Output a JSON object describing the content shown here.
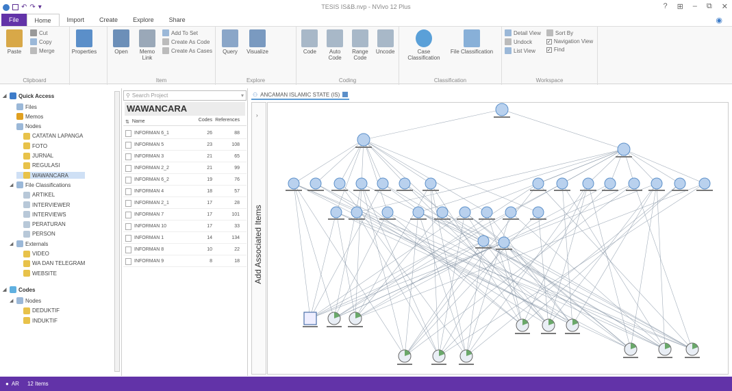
{
  "window": {
    "title": "TESIS IS&B.nvp - NVivo 12 Plus",
    "quick_access": [
      "save-icon",
      "undo-icon",
      "redo-icon",
      "dropdown-icon"
    ],
    "controls": [
      "?",
      "⊞",
      "–",
      "⧉",
      "✕"
    ]
  },
  "tabs": [
    {
      "label": "File",
      "kind": "file"
    },
    {
      "label": "Home",
      "kind": "active"
    },
    {
      "label": "Import",
      "kind": ""
    },
    {
      "label": "Create",
      "kind": ""
    },
    {
      "label": "Explore",
      "kind": ""
    },
    {
      "label": "Share",
      "kind": ""
    }
  ],
  "ribbon": {
    "clipboard": {
      "label": "Clipboard",
      "paste": "Paste",
      "cut": "Cut",
      "copy": "Copy",
      "merge": "Merge"
    },
    "properties": {
      "label": "",
      "properties": "Properties"
    },
    "item": {
      "label": "Item",
      "open": "Open",
      "memo_link": "Memo Link",
      "add_to_set": "Add To Set",
      "create_as_code": "Create As Code",
      "create_as_cases": "Create As Cases"
    },
    "explore": {
      "label": "Explore",
      "query": "Query",
      "visualize": "Visualize"
    },
    "coding": {
      "label": "Coding",
      "code": "Code",
      "auto_code": "Auto Code",
      "range_code": "Range Code",
      "uncode": "Uncode"
    },
    "classification": {
      "label": "Classification",
      "case": "Case Classification",
      "file": "File Classification"
    },
    "workspace": {
      "label": "Workspace",
      "detail_view": "Detail View",
      "sort_by": "Sort By",
      "undock": "Undock",
      "navigation_view": "Navigation View",
      "list_view": "List View",
      "find": "Find"
    }
  },
  "nav": {
    "items": [
      {
        "label": "Quick Access",
        "level": 0,
        "bold": true,
        "exp": "◢",
        "color": "#3d7cc9"
      },
      {
        "label": "Files",
        "level": 1,
        "color": "#9bb8d8"
      },
      {
        "label": "Memos",
        "level": 1,
        "color": "#e0a020"
      },
      {
        "label": "Nodes",
        "level": 1,
        "color": "#9bb8d8"
      },
      {
        "label": "CATATAN LAPANGA",
        "level": 2,
        "color": "#e8c24a"
      },
      {
        "label": "FOTO",
        "level": 2,
        "color": "#e8c24a"
      },
      {
        "label": "JURNAL",
        "level": 2,
        "color": "#e8c24a"
      },
      {
        "label": "REGULASI",
        "level": 2,
        "color": "#e8c24a"
      },
      {
        "label": "WAWANCARA",
        "level": 2,
        "color": "#e8c24a",
        "selected": true
      },
      {
        "label": "File Classifications",
        "level": 1,
        "exp": "◢",
        "color": "#9bb8d8"
      },
      {
        "label": "ARTIKEL",
        "level": 2,
        "color": "#b8c8d8"
      },
      {
        "label": "INTERVIEWER",
        "level": 2,
        "color": "#b8c8d8"
      },
      {
        "label": "INTERVIEWS",
        "level": 2,
        "color": "#b8c8d8"
      },
      {
        "label": "PERATURAN",
        "level": 2,
        "color": "#b8c8d8"
      },
      {
        "label": "PERSON",
        "level": 2,
        "color": "#b8c8d8"
      },
      {
        "label": "Externals",
        "level": 1,
        "exp": "◢",
        "color": "#9bb8d8"
      },
      {
        "label": "VIDEO",
        "level": 2,
        "color": "#e8c24a"
      },
      {
        "label": "WA DAN TELEGRAM",
        "level": 2,
        "color": "#e8c24a"
      },
      {
        "label": "WEBSITE",
        "level": 2,
        "color": "#e8c24a"
      },
      {
        "label": "",
        "level": 0,
        "spacer": true
      },
      {
        "label": "Codes",
        "level": 0,
        "bold": true,
        "exp": "◢",
        "color": "#5fb0e0"
      },
      {
        "label": "Nodes",
        "level": 1,
        "exp": "◢",
        "color": "#9bb8d8"
      },
      {
        "label": "DEDUKTIF",
        "level": 2,
        "color": "#e8c24a"
      },
      {
        "label": "INDUKTIF",
        "level": 2,
        "color": "#e8c24a"
      }
    ]
  },
  "list": {
    "search_placeholder": "Search Project",
    "title": "WAWANCARA",
    "headers": [
      "Name",
      "Codes",
      "References"
    ],
    "rows": [
      [
        "INFORMAN 6_1",
        "26",
        "88"
      ],
      [
        "INFORMAN 5",
        "23",
        "108"
      ],
      [
        "INFORMAN 3",
        "21",
        "65"
      ],
      [
        "INFORMAN 2_2",
        "21",
        "99"
      ],
      [
        "INFORMAN 6_2",
        "19",
        "76"
      ],
      [
        "INFORMAN 4",
        "18",
        "57"
      ],
      [
        "INFORMAN 2_1",
        "17",
        "28"
      ],
      [
        "INFORMAN 7",
        "17",
        "101"
      ],
      [
        "INFORMAN 10",
        "17",
        "33"
      ],
      [
        "INFORMAN 1",
        "14",
        "134"
      ],
      [
        "INFORMAN 8",
        "10",
        "22"
      ],
      [
        "INFORMAN 9",
        "8",
        "18"
      ]
    ]
  },
  "detail": {
    "tab_label": "ANCAMAN ISLAMIC STATE (IS)",
    "side_label": "Add Associated Items",
    "chevron": "›"
  },
  "status": {
    "user": "AR",
    "items": "12 Items"
  },
  "colors": {
    "accent": "#6233a8",
    "node": "#b9d1ee",
    "node_stroke": "#5b8fc9",
    "edge": "#8a98a8"
  }
}
